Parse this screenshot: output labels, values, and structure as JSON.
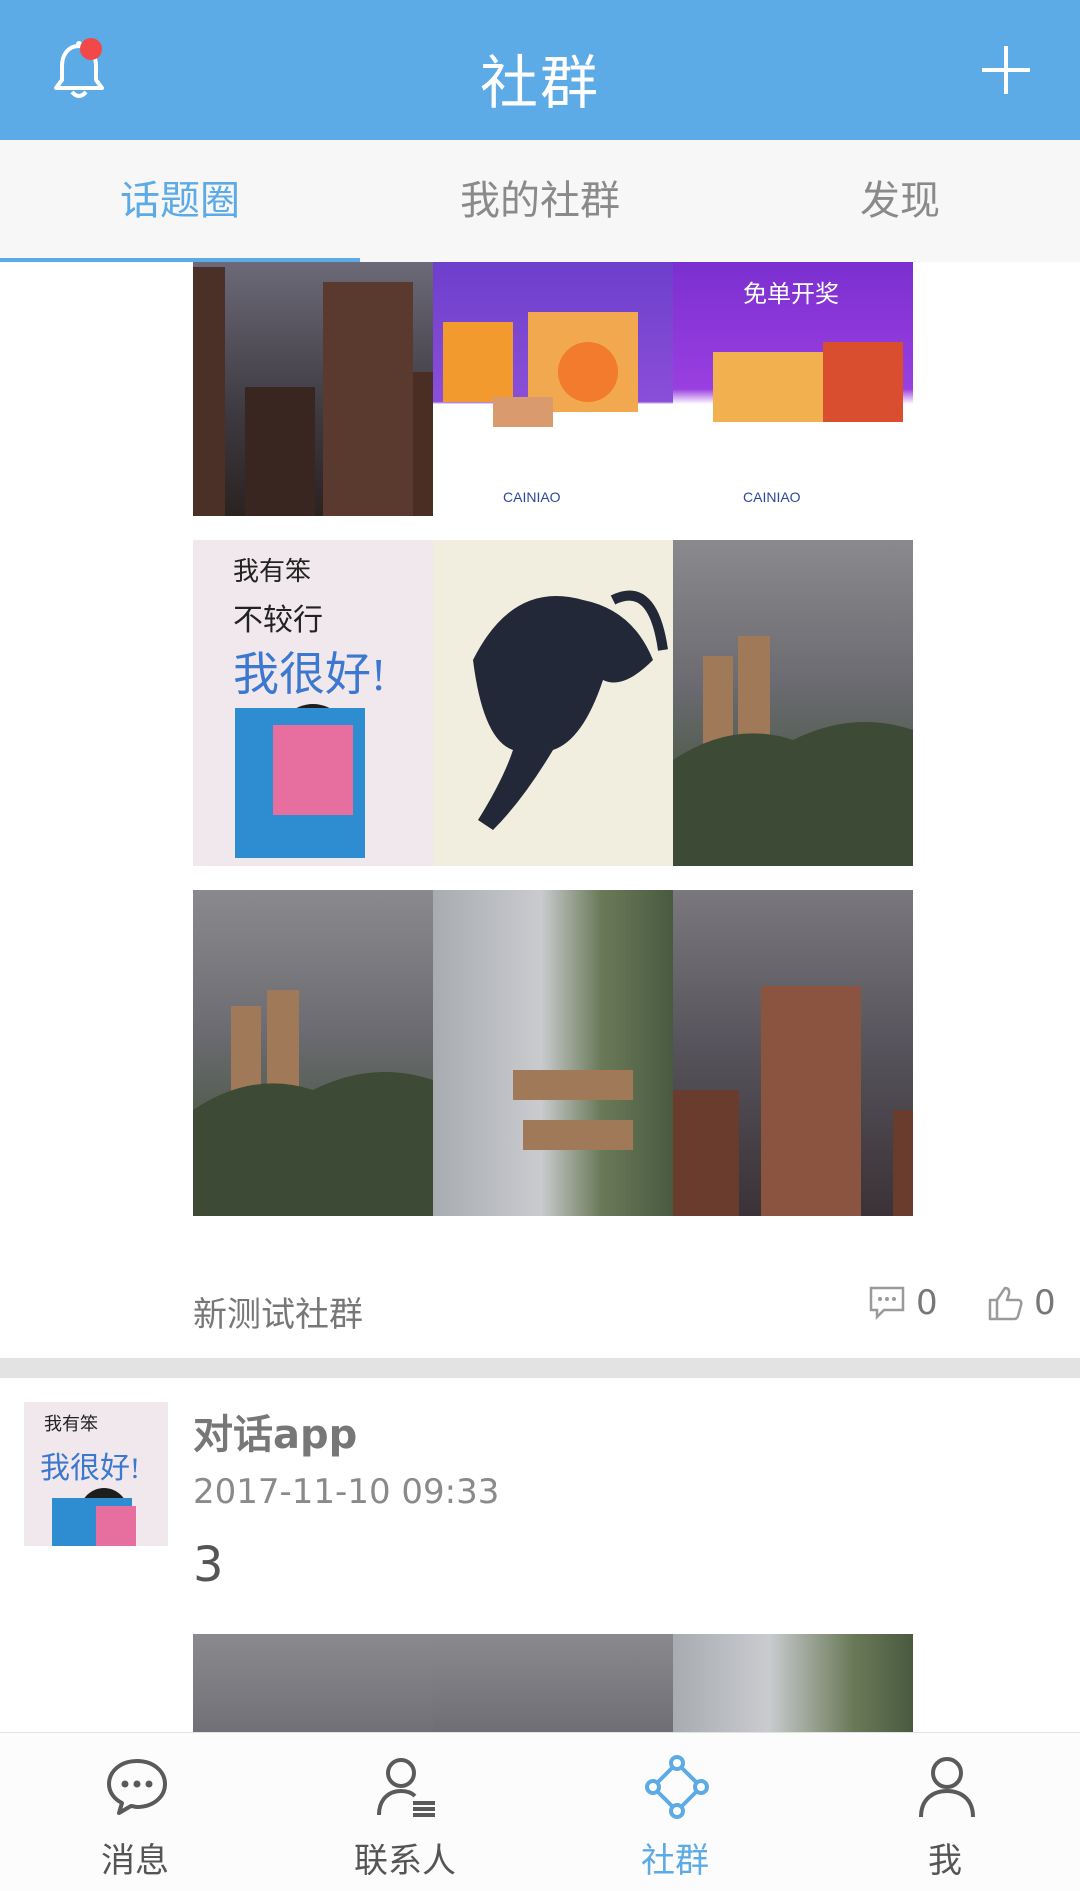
{
  "header": {
    "title": "社群"
  },
  "tabs": [
    {
      "label": "话题圈",
      "active": true
    },
    {
      "label": "我的社群",
      "active": false
    },
    {
      "label": "发现",
      "active": false
    }
  ],
  "post1": {
    "community": "新测试社群",
    "comments": "0",
    "likes": "0"
  },
  "post2": {
    "title": "对话app",
    "time": "2017-11-10 09:33",
    "text": "3"
  },
  "bottom_nav": [
    {
      "label": "消息",
      "icon": "chat-bubble-icon"
    },
    {
      "label": "联系人",
      "icon": "contacts-icon"
    },
    {
      "label": "社群",
      "icon": "community-icon",
      "active": true
    },
    {
      "label": "我",
      "icon": "person-icon"
    }
  ],
  "colors": {
    "primary": "#5caae6",
    "badge": "#f24848",
    "text": "#777777"
  }
}
